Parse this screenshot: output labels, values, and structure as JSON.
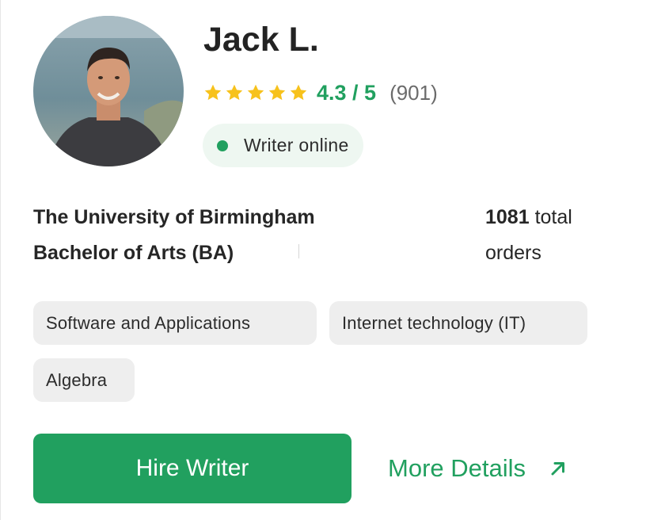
{
  "writer": {
    "name": "Jack L.",
    "rating": {
      "stars": 5,
      "score": "4.3 / 5",
      "count": "(901)"
    },
    "status": "Writer online",
    "education": {
      "university": "The University of Birmingham",
      "degree": "Bachelor of Arts (BA)"
    },
    "orders": {
      "count": "1081",
      "label": "total",
      "label2": "orders"
    },
    "tags": [
      "Software and Applications",
      "Internet technology (IT)",
      "Algebra"
    ]
  },
  "actions": {
    "hire_label": "Hire Writer",
    "details_label": "More Details"
  },
  "icons": {
    "star": "star-icon",
    "arrow": "arrow-up-right-icon",
    "status": "online-dot-icon"
  },
  "colors": {
    "accent": "#21a05f",
    "star": "#f7c21c",
    "status_bg": "#eef7f1",
    "tag_bg": "#eeeeee"
  }
}
